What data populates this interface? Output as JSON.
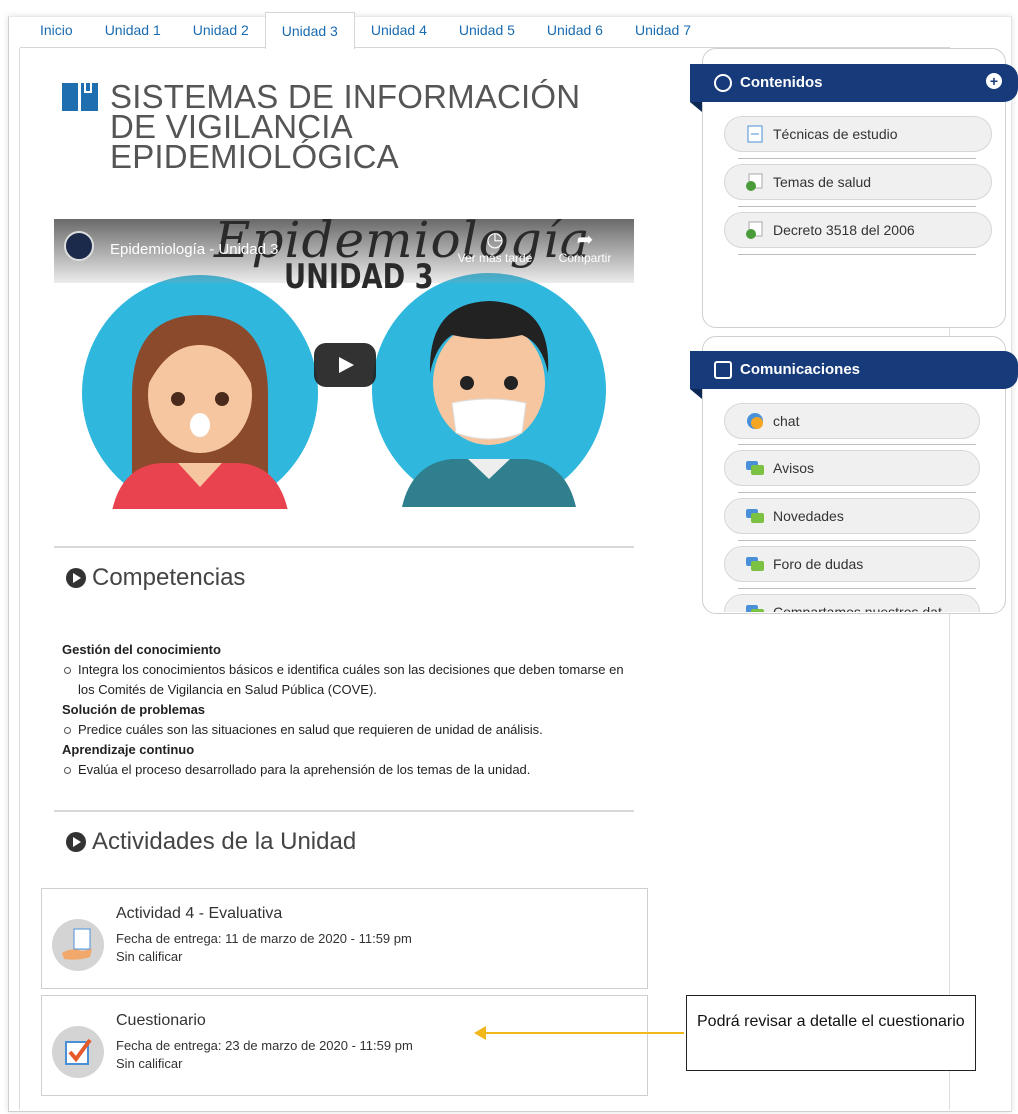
{
  "tabs": [
    "Inicio",
    "Unidad 1",
    "Unidad 2",
    "Unidad 3",
    "Unidad 4",
    "Unidad 5",
    "Unidad 6",
    "Unidad 7"
  ],
  "active_tab": "Unidad 3",
  "page_title": "SISTEMAS DE INFORMACIÓN DE VIGILANCIA EPIDEMIOLÓGICA",
  "video": {
    "title": "Epidemiología - Unidad 3",
    "watch_later": "Ver más tarde",
    "share": "Compartir",
    "overlay_script": "Epidemiología",
    "overlay_unit": "UNIDAD 3"
  },
  "competencias": {
    "title": "Competencias",
    "groups": [
      {
        "heading": "Gestión del conocimiento",
        "items": [
          "Integra los conocimientos básicos e identifica cuáles son las decisiones que deben tomarse en los Comités de Vigilancia en Salud Pública (COVE)."
        ]
      },
      {
        "heading": "Solución de problemas",
        "items": [
          "Predice cuáles son las situaciones en salud que requieren de unidad de análisis."
        ]
      },
      {
        "heading": "Aprendizaje continuo",
        "items": [
          "Evalúa el proceso desarrollado para la aprehensión de los temas de la unidad."
        ]
      }
    ]
  },
  "actividades": {
    "title": "Actividades de la Unidad",
    "items": [
      {
        "title": "Actividad 4 - Evaluativa",
        "date": "Fecha de entrega: 11 de marzo de 2020 - 11:59 pm",
        "status": "Sin calificar",
        "icon": "document-hand-icon"
      },
      {
        "title": "Cuestionario",
        "date": "Fecha de entrega: 23 de marzo de 2020 - 11:59 pm",
        "status": "Sin calificar",
        "icon": "checkbox-icon"
      }
    ]
  },
  "contenidos": {
    "title": "Contenidos",
    "items": [
      "Técnicas de estudio",
      "Temas de salud",
      "Decreto 3518 del 2006"
    ]
  },
  "comunicaciones": {
    "title": "Comunicaciones",
    "items": [
      "chat",
      "Avisos",
      "Novedades",
      "Foro de dudas",
      "Compartamos nuestros dat"
    ]
  },
  "callout": "Podrá revisar a detalle el cuestionario",
  "colors": {
    "accent": "#1a6bb0",
    "panel_header": "#173a7a",
    "arrow": "#f2b71b"
  }
}
